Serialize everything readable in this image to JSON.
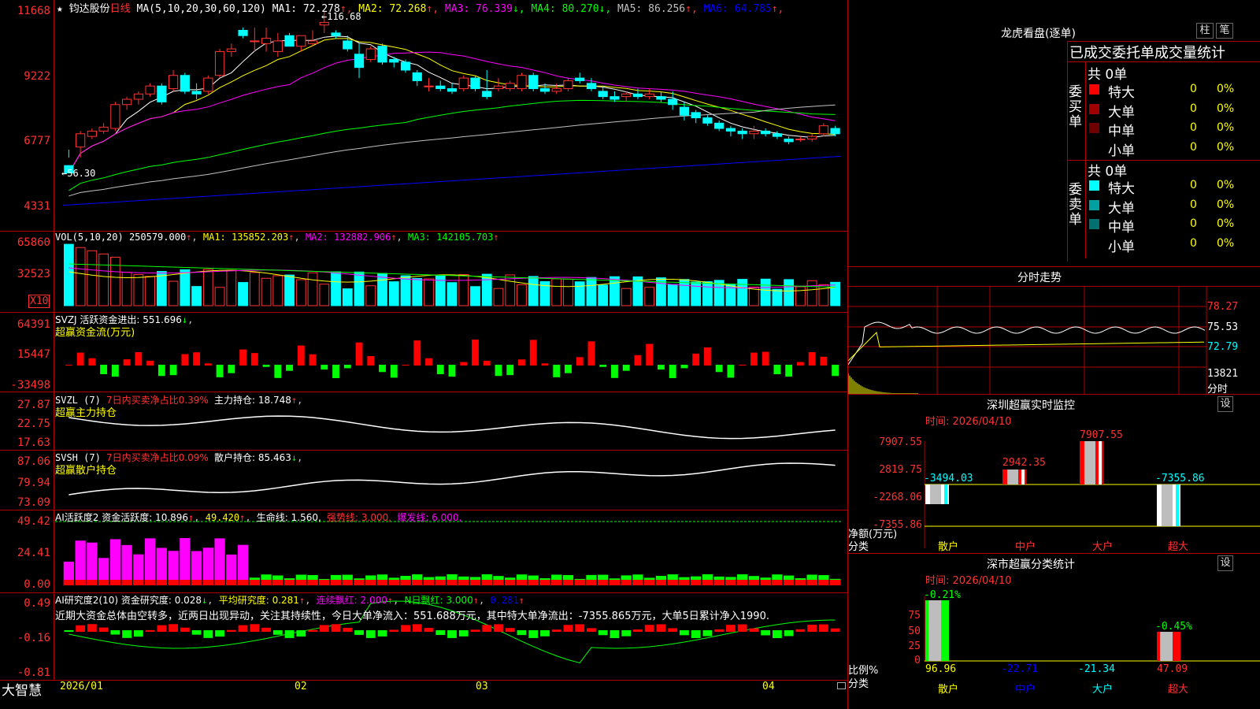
{
  "header": {
    "star": "★",
    "stock_name": "钧达股份",
    "period": "日线",
    "ma_params": "MA(5,10,20,30,60,120)",
    "ma": [
      {
        "label": "MA1:",
        "value": "72.278",
        "arrow": "↑",
        "color": "#ffffff"
      },
      {
        "label": "MA2:",
        "value": "72.268",
        "arrow": "↑",
        "color": "#ffff00"
      },
      {
        "label": "MA3:",
        "value": "76.339",
        "arrow": "↓",
        "color": "#ff00ff"
      },
      {
        "label": "MA4:",
        "value": "80.270",
        "arrow": "↓",
        "color": "#00ff00"
      },
      {
        "label": "MA5:",
        "value": "86.256",
        "arrow": "↑",
        "color": "#c0c0c0"
      },
      {
        "label": "MA6:",
        "value": "64.785",
        "arrow": "↑",
        "color": "#0000ff"
      }
    ],
    "high_mark": "116.68",
    "low_mark": "56.30"
  },
  "price_axis": [
    "11668",
    "9222",
    "6777",
    "4331"
  ],
  "vol": {
    "title": "VOL(5,10,20)",
    "value": "250579.000",
    "ma1": "MA1: 135852.203",
    "ma2": "MA2: 132882.906",
    "ma3": "MA3: 142105.703",
    "axis": [
      "65860",
      "32523"
    ],
    "unit": "X10"
  },
  "svzj": {
    "title": "SVZJ  活跃资金进出: 551.696",
    "subtitle": "超赢资金流(万元)",
    "axis": [
      "64391",
      "15447",
      "-33498"
    ]
  },
  "svzl": {
    "title": "SVZL (7)",
    "red_text": "7日内买卖净占比0.39%",
    "value": "主力持仓: 18.748",
    "subtitle": "超赢主力持仓",
    "axis": [
      "27.87",
      "22.75",
      "17.63"
    ]
  },
  "svsh": {
    "title": "SVSH (7)",
    "red_text": "7日内买卖净占比0.09%",
    "value": "散户持仓: 85.463",
    "subtitle": "超赢散户持仓",
    "axis": [
      "87.06",
      "79.94",
      "73.09"
    ]
  },
  "ai_active": {
    "title": "AI活跃度2 资金活跃度: 10.896",
    "v2": "49.420",
    "v3": "生命线: 1.560,",
    "v4": "强势线: 3.000,",
    "v5": "爆发线: 6.000,",
    "axis": [
      "49.42",
      "24.41",
      "0.00"
    ]
  },
  "ai_research": {
    "title": "AI研究度2(10) 资金研究度: 0.028",
    "avg": "平均研究度: 0.281",
    "cont": "连续飘红: 2.000",
    "nday": "N日飘红: 3.000",
    "last": "0.281",
    "comment": "近期大资金总体由空转多，近两日出现异动，关注其持续性，今日大单净流入：551.688万元，其中特大单净流出：-7355.865万元，大单5日累计净入1990.",
    "axis": [
      "0.49",
      "-0.16",
      "-0.81"
    ]
  },
  "footer": {
    "brand": "大智慧",
    "months": [
      "2026/01",
      "02",
      "03",
      "04"
    ]
  },
  "right_panel": {
    "lhb_title": "龙虎看盘(逐单)",
    "btn1": "柱",
    "btn2": "笔",
    "tabs": "已成交委托单成交量统计",
    "buy_label": "委买单",
    "sell_label": "委卖单",
    "buy_total": "共 0单",
    "sell_total": "共 0单",
    "buy_rows": [
      {
        "name": "特大",
        "count": "0",
        "pct": "0%",
        "color": "#ff0000"
      },
      {
        "name": "大单",
        "count": "0",
        "pct": "0%",
        "color": "#a00000"
      },
      {
        "name": "中单",
        "count": "0",
        "pct": "0%",
        "color": "#700000"
      },
      {
        "name": "小单",
        "count": "0",
        "pct": "0%",
        "color": "#000000"
      }
    ],
    "sell_rows": [
      {
        "name": "特大",
        "count": "0",
        "pct": "0%",
        "color": "#00ffff"
      },
      {
        "name": "大单",
        "count": "0",
        "pct": "0%",
        "color": "#00a0a0"
      },
      {
        "name": "中单",
        "count": "0",
        "pct": "0%",
        "color": "#007070"
      },
      {
        "name": "小单",
        "count": "0",
        "pct": "0%",
        "color": "#000000"
      }
    ],
    "fenshi_title": "分时走势",
    "fenshi_axis": [
      "78.27",
      "75.53",
      "72.79",
      "13821"
    ],
    "fenshi_unit": "分时",
    "sz_monitor_title": "深圳超赢实时监控",
    "sz_settings": "设",
    "sz_time": "时间: 2026/04/10",
    "sz_axis": [
      "7907.55",
      "2819.75",
      "-2268.06",
      "-7355.86"
    ],
    "sz_unit_1": "净额(万元)",
    "sz_unit_2": "分类",
    "sz_cats": [
      "散户",
      "中户",
      "大户",
      "超大"
    ],
    "sz_values": [
      "-3494.03",
      "2942.35",
      "7907.55",
      "-7355.86"
    ],
    "cls_title": "深市超赢分类统计",
    "cls_settings": "设",
    "cls_time": "时间: 2026/04/10",
    "cls_axis": [
      "75",
      "50",
      "25",
      "0"
    ],
    "cls_unit_1": "比例%",
    "cls_unit_2": "分类",
    "cls_top": [
      "-0.21%",
      "-0.45%"
    ],
    "cls_values": [
      "96.96",
      "-22.71",
      "-21.34",
      "47.09"
    ],
    "cls_cats": [
      "散户",
      "中户",
      "大户",
      "超大"
    ]
  },
  "chart_data": {
    "type": "candlestick",
    "title": "钧达股份 日线",
    "x_labels": [
      "2026/01",
      "02",
      "03",
      "04"
    ],
    "ylim": [
      4331,
      11668
    ],
    "ohlc": [
      [
        5900,
        6500,
        6200,
        5620
      ],
      [
        6600,
        7200,
        6200,
        7100
      ],
      [
        7000,
        7300,
        6900,
        7200
      ],
      [
        7200,
        7500,
        7100,
        7350
      ],
      [
        7300,
        8300,
        7200,
        8200
      ],
      [
        8200,
        8500,
        8000,
        8400
      ],
      [
        8400,
        8700,
        8200,
        8600
      ],
      [
        8600,
        9000,
        8500,
        8900
      ],
      [
        8900,
        9000,
        8200,
        8300
      ],
      [
        8800,
        9500,
        8700,
        9300
      ],
      [
        9300,
        9400,
        8600,
        8700
      ],
      [
        8700,
        9000,
        8400,
        8600
      ],
      [
        8700,
        9300,
        8600,
        9200
      ],
      [
        9300,
        10300,
        9200,
        10200
      ],
      [
        10200,
        10500,
        10000,
        10300
      ],
      [
        11000,
        11100,
        10700,
        10800
      ],
      [
        10600,
        11100,
        10200,
        10600
      ],
      [
        10500,
        11100,
        10200,
        10700
      ],
      [
        10200,
        10900,
        10000,
        10600
      ],
      [
        10800,
        10900,
        10400,
        10400
      ],
      [
        10400,
        10800,
        10200,
        10800
      ],
      [
        10500,
        11000,
        10400,
        10600
      ],
      [
        11200,
        11700,
        10900,
        11300
      ],
      [
        10900,
        11000,
        10700,
        10800
      ],
      [
        10600,
        10800,
        10200,
        10300
      ],
      [
        10100,
        10500,
        9200,
        9600
      ],
      [
        9900,
        10400,
        9800,
        10300
      ],
      [
        10400,
        10500,
        9700,
        9800
      ],
      [
        9900,
        10000,
        9600,
        9800
      ],
      [
        9800,
        9900,
        9400,
        9500
      ],
      [
        9400,
        9500,
        8900,
        9100
      ],
      [
        8900,
        9200,
        8700,
        8900
      ],
      [
        8900,
        9100,
        8700,
        8800
      ],
      [
        8800,
        9000,
        8600,
        8700
      ],
      [
        8800,
        9300,
        8700,
        9200
      ],
      [
        9200,
        9300,
        8700,
        8800
      ],
      [
        8700,
        9500,
        8400,
        8500
      ],
      [
        8800,
        9200,
        8700,
        8900
      ],
      [
        8800,
        9100,
        8700,
        9000
      ],
      [
        8800,
        9400,
        8700,
        9300
      ],
      [
        9300,
        9400,
        8700,
        8800
      ],
      [
        8800,
        9000,
        8600,
        8700
      ],
      [
        8700,
        9000,
        8600,
        8800
      ],
      [
        8800,
        9200,
        8700,
        9100
      ],
      [
        9200,
        9400,
        9000,
        9100
      ],
      [
        9000,
        9200,
        8700,
        8800
      ],
      [
        8700,
        8900,
        8400,
        8500
      ],
      [
        8500,
        8700,
        8300,
        8400
      ],
      [
        8500,
        8700,
        8300,
        8600
      ],
      [
        8600,
        8800,
        8400,
        8500
      ],
      [
        8500,
        8800,
        8400,
        8600
      ],
      [
        8500,
        8700,
        8300,
        8400
      ],
      [
        8400,
        8700,
        8000,
        8200
      ],
      [
        8100,
        8300,
        7600,
        7800
      ],
      [
        7900,
        8000,
        7500,
        7700
      ],
      [
        7700,
        7800,
        7400,
        7500
      ],
      [
        7500,
        7600,
        7200,
        7300
      ],
      [
        7300,
        7400,
        7000,
        7200
      ],
      [
        7200,
        7300,
        6900,
        7100
      ],
      [
        7100,
        7400,
        6900,
        7200
      ],
      [
        7200,
        7300,
        7000,
        7100
      ],
      [
        7100,
        7200,
        6900,
        7000
      ],
      [
        6900,
        7000,
        6700,
        6800
      ],
      [
        6900,
        7000,
        6800,
        6900
      ],
      [
        6900,
        7100,
        6800,
        7000
      ],
      [
        7100,
        7500,
        7000,
        7400
      ],
      [
        7300,
        7400,
        7000,
        7100
      ]
    ]
  }
}
